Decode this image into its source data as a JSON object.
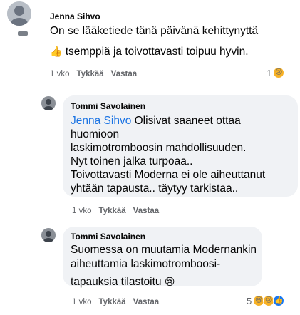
{
  "comments": [
    {
      "author": "Jenna Sihvo",
      "lines": [
        "On se lääketiede tänä päivänä kehittynyttä",
        "tsemppiä ja toivottavasti toipuu hyvin."
      ],
      "emoji": "👍",
      "time": "1 vko",
      "like_label": "Tykkää",
      "reply_label": "Vastaa",
      "reaction_count": "1",
      "reaction_icons": [
        "sad-icon"
      ]
    },
    {
      "author": "Tommi Savolainen",
      "mention": "Jenna Sihvo",
      "lines": [
        "Olisivat saaneet ottaa",
        "huomioon",
        "laskimotromboosin mahdollisuuden.",
        "Nyt toinen jalka turpoaa..",
        "Toivottavasti Moderna ei ole aiheuttanut",
        "yhtään tapausta.. täytyy tarkistaa.."
      ],
      "time": "1 vko",
      "like_label": "Tykkää",
      "reply_label": "Vastaa"
    },
    {
      "author": "Tommi Savolainen",
      "lines": [
        "Suomessa on muutamia Modernankin",
        "aiheuttamia laskimotromboosi-",
        "tapauksia tilastoitu"
      ],
      "emoji": "😢",
      "time": "1 vko",
      "like_label": "Tykkää",
      "reply_label": "Vastaa",
      "reaction_count": "5",
      "reaction_icons": [
        "haha-icon",
        "sad-icon",
        "like-icon"
      ]
    }
  ]
}
